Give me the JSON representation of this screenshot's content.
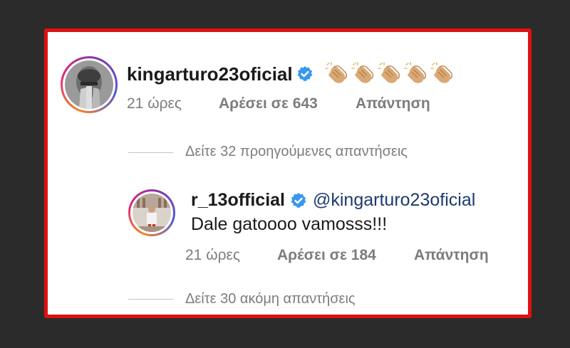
{
  "comment": {
    "username": "kingarturo23oficial",
    "emoji": "👏🏼👏🏼👏🏼👏🏼👏🏼",
    "time": "21 ώρες",
    "likes": "Αρέσει σε 643",
    "reply": "Απάντηση",
    "view_previous": "Δείτε 32 προηγούμενες απαντήσεις"
  },
  "reply_comment": {
    "username": "r_13official",
    "mention": "@kingarturo23oficial",
    "text": "Dale gatoooo vamosss!!!",
    "time": "21 ώρες",
    "likes": "Αρέσει σε 184",
    "reply": "Απάντηση",
    "view_more": "Δείτε 30 ακόμη απαντήσεις"
  },
  "colors": {
    "highlight_border": "#e01010",
    "verified_blue": "#3897f0",
    "mention_blue": "#1e3a6e",
    "meta_gray": "#7c7c7c"
  },
  "icons": {
    "verified": "verified-badge-icon",
    "clap": "clapping-hands-icon"
  }
}
